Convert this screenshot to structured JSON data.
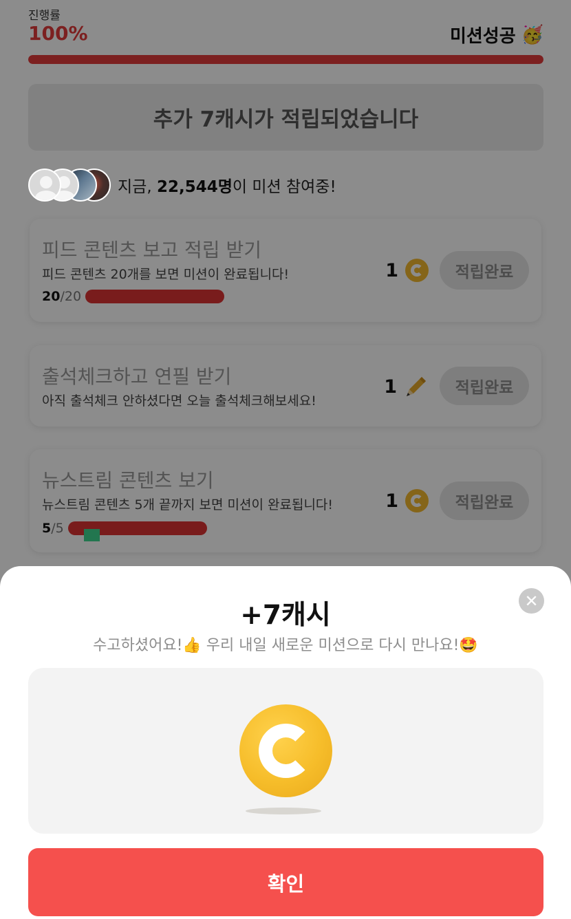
{
  "header": {
    "progress_label": "진행률",
    "progress_percent": "100%",
    "progress_value": 1.0,
    "mission_status": "미션성공",
    "mission_status_icon": "party-face-icon",
    "accent_color": "#e23b3b"
  },
  "banner": {
    "text": "추가 7캐시가 적립되었습니다"
  },
  "participants": {
    "prefix": "지금, ",
    "count": "22,544명",
    "suffix": "이 미션 참여중!"
  },
  "missions": [
    {
      "title": "피드 콘텐츠 보고 적립 받기",
      "description": "피드 콘텐츠 20개를 보면 미션이 완료됩니다!",
      "reward": "1",
      "reward_icon": "coin-icon",
      "button": "적립완료",
      "progress_current": "20",
      "progress_total": "/20",
      "progress_value": 1.0
    },
    {
      "title": "출석체크하고 연필 받기",
      "description": "아직 출석체크 안하셨다면 오늘 출석체크해보세요!",
      "reward": "1",
      "reward_icon": "pencil-icon",
      "button": "적립완료"
    },
    {
      "title": "뉴스트림 콘텐츠 보기",
      "description": "뉴스트림 콘텐츠 5개 끝까지 보면 미션이 완료됩니다!",
      "reward": "1",
      "reward_icon": "coin-icon",
      "button": "적립완료",
      "progress_current": "5",
      "progress_total": "/5",
      "progress_value": 1.0
    }
  ],
  "sheet": {
    "title": "+7캐시",
    "subtitle": "수고하셨어요!👍 우리 내일 새로운 미션으로 다시 만나요!🤩",
    "close_icon": "close-icon",
    "coin_icon": "cash-coin-icon",
    "confirm_label": "확인",
    "confirm_color": "#f5504d"
  }
}
